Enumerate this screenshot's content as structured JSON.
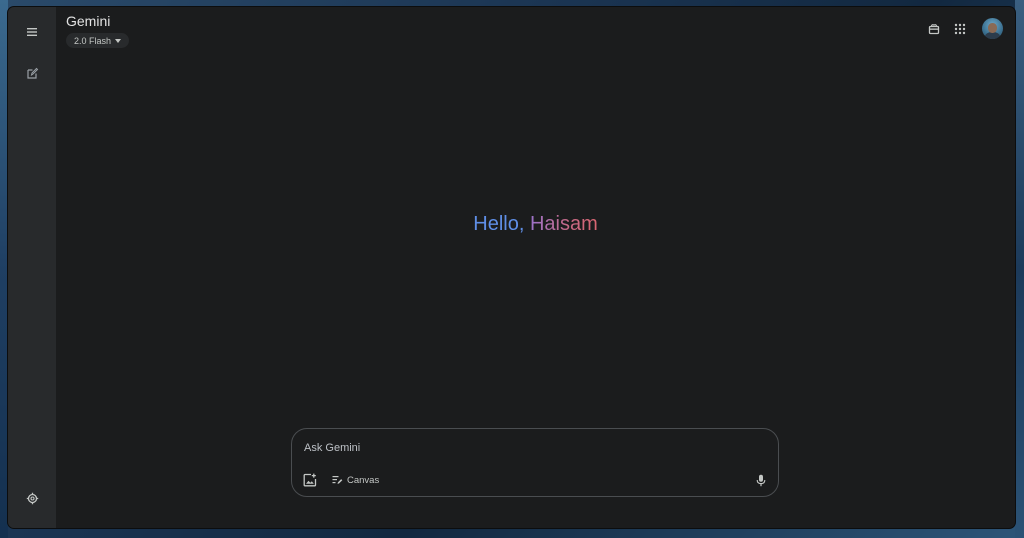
{
  "header": {
    "app_title": "Gemini",
    "model_label": "2.0 Flash"
  },
  "greeting": {
    "hello": "Hello,",
    "name": "Haisam"
  },
  "prompt": {
    "placeholder": "Ask Gemini",
    "value": "",
    "canvas_label": "Canvas"
  },
  "icons": {
    "sidebar": [
      "menu-icon",
      "new-chat-icon",
      "settings-icon"
    ],
    "top_right": [
      "gift-icon",
      "apps-grid-icon",
      "avatar"
    ],
    "prompt": [
      "upload-image-icon",
      "canvas-icon",
      "mic-icon"
    ]
  },
  "colors": {
    "window_bg": "#1b1c1d",
    "sidebar_bg": "#282a2c",
    "text_primary": "#e3e3e3",
    "greeting_blue": "#5f8ee6",
    "greeting_red": "#d96570"
  }
}
